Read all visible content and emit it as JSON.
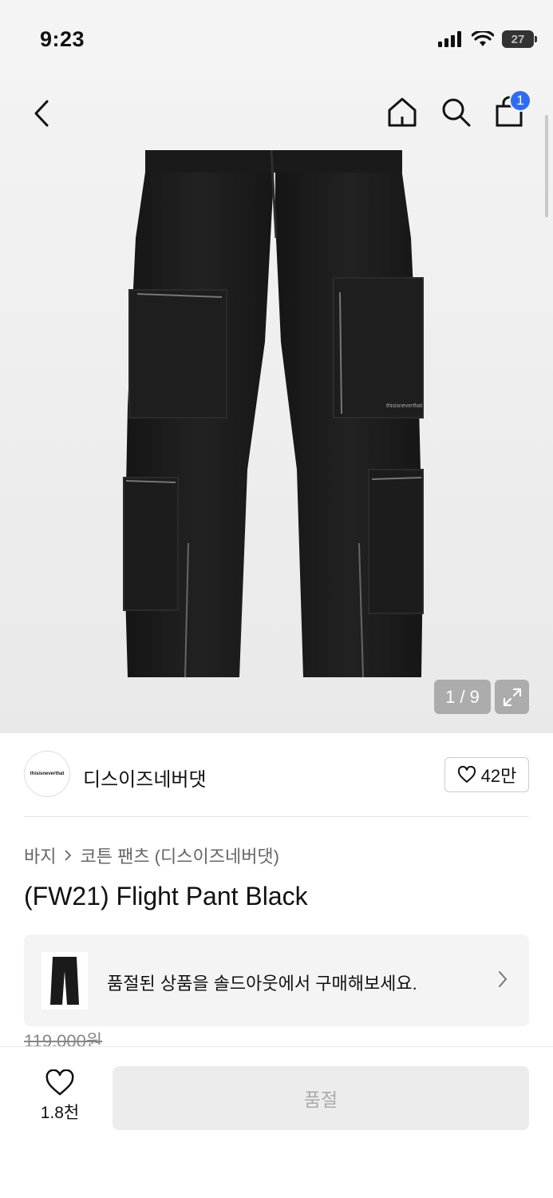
{
  "status_bar": {
    "time": "9:23",
    "battery": "27"
  },
  "header": {
    "cart_count": "1",
    "icons": [
      "back-icon",
      "home-icon",
      "search-icon",
      "shopping-bag-icon"
    ]
  },
  "gallery": {
    "counter": "1 / 9",
    "image_description_icon": "pants-photo"
  },
  "brand": {
    "logo_text": "thisisneverthat",
    "name": "디스이즈네버댓",
    "like_count": "42만"
  },
  "breadcrumb": {
    "category": "바지",
    "subcategory": "코튼 팬츠 (디스이즈네버댓)"
  },
  "product": {
    "title": "(FW21) Flight Pant Black",
    "original_price": "119,000원"
  },
  "soldout_banner": {
    "text": "품절된 상품을 솔드아웃에서 구매해보세요."
  },
  "bottom_bar": {
    "wish_count": "1.8천",
    "action_label": "품절"
  },
  "colors": {
    "badge": "#2f6cf6",
    "pants": "#1c1c1c"
  }
}
